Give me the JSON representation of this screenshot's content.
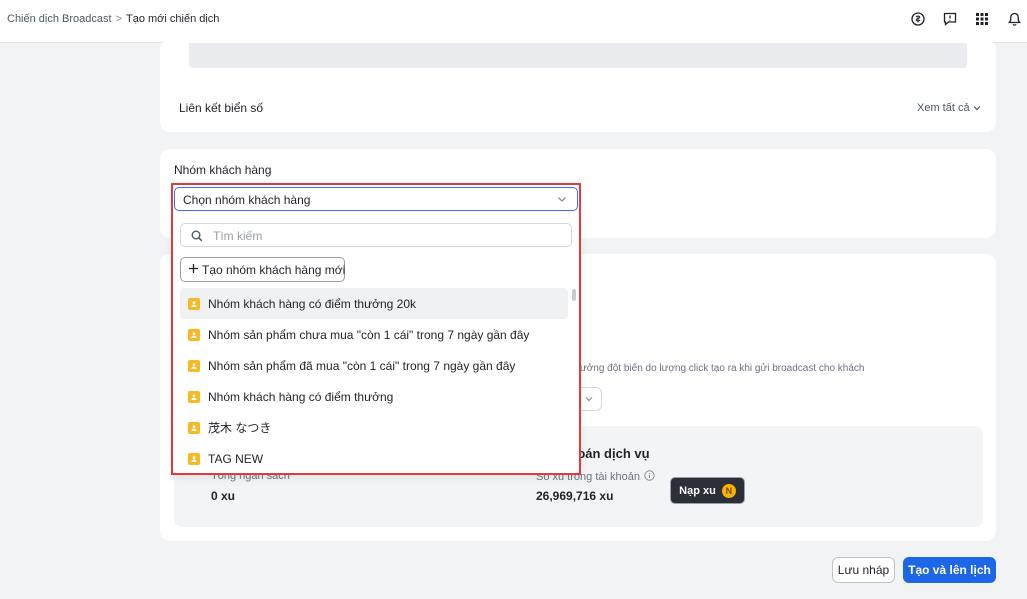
{
  "breadcrumb": {
    "parent": "Chiến dịch Broadcast",
    "separator": ">",
    "current": "Tạo mới chiến dịch"
  },
  "topbar_icons": [
    "clock-dollar-icon",
    "feedback-icon",
    "apps-grid-icon",
    "bell-icon"
  ],
  "plates_section": {
    "label": "Liên kết biển số",
    "see_all": "Xem tất cả"
  },
  "customer_group": {
    "label": "Nhóm khách hàng",
    "select_placeholder": "Chọn nhóm khách hàng",
    "search_placeholder": "Tìm kiếm",
    "create_button": "Tạo nhóm khách hàng mới",
    "options": [
      "Nhóm khách hàng có điểm thưởng 20k",
      "Nhóm sản phẩm chưa mua \"còn 1 cái\" trong 7 ngày gần đây",
      "Nhóm sản phẩm đã mua \"còn 1 cái\" trong 7 ngày gần đây",
      "Nhóm khách hàng có điểm thưởng",
      "茂木 なつき",
      "TAG NEW"
    ]
  },
  "hint_text": "ng trưởng đột biến do lượng click tạo ra khi gửi broadcast cho khách",
  "billing": {
    "title": "toán dịch vụ",
    "budget_label": "Tổng ngân sách",
    "budget_value": "0 xu",
    "balance_label": "Số xu trong tài khoản",
    "balance_value": "26,969,716 xu",
    "topup_button": "Nạp xu"
  },
  "actions": {
    "save_draft": "Lưu nháp",
    "create_schedule": "Tạo và lên lịch"
  },
  "colors": {
    "primary": "#1e66e8",
    "highlight": "#e23b3b",
    "tag": "#f7b924",
    "coin": "#f5b400"
  }
}
